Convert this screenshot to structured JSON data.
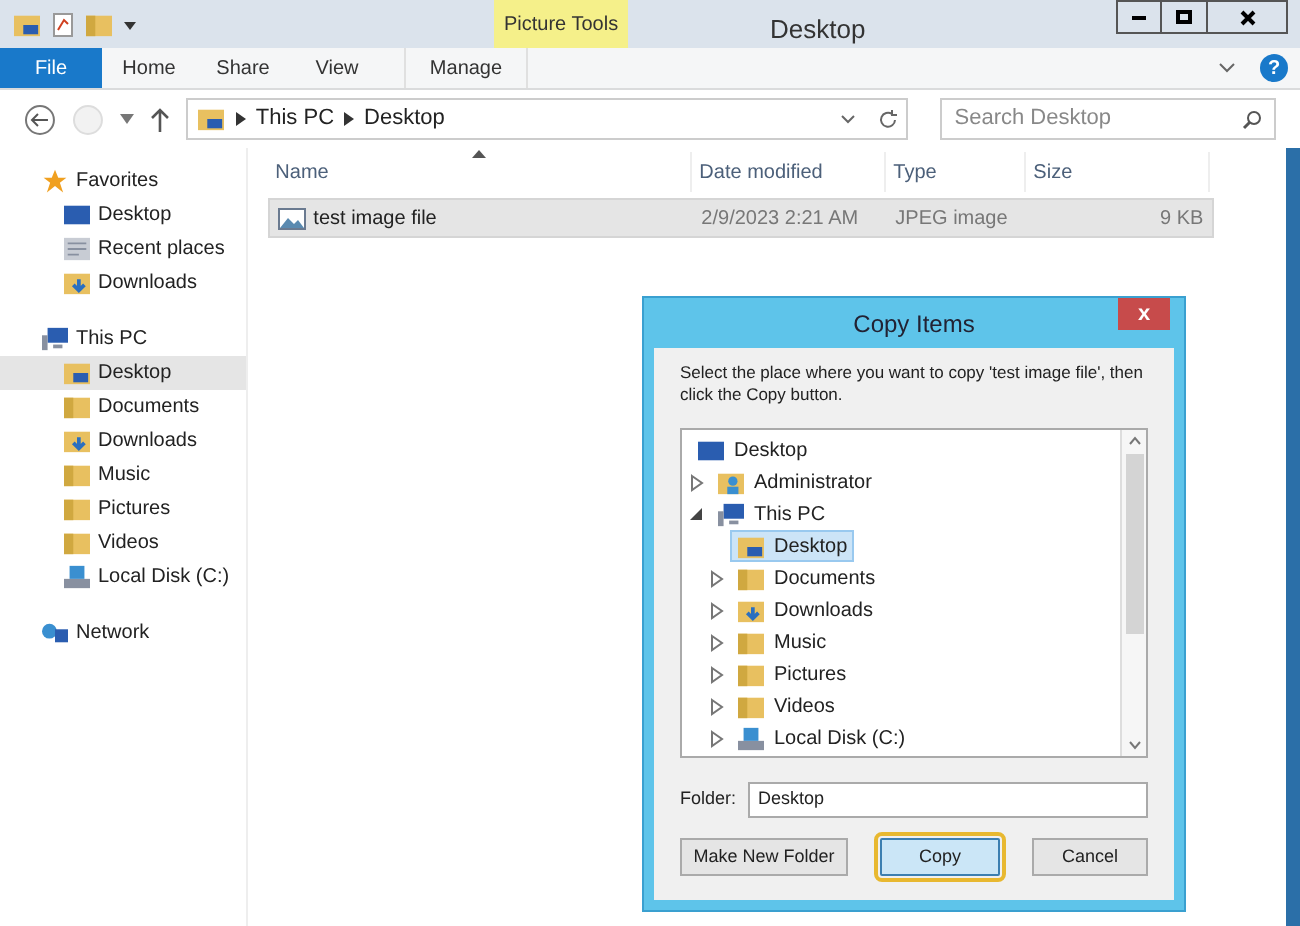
{
  "window": {
    "title": "Desktop",
    "context_tab": "Picture Tools",
    "help": "?"
  },
  "ribbon_tabs": [
    {
      "label": "File",
      "kind": "file"
    },
    {
      "label": "Home",
      "kind": "tab"
    },
    {
      "label": "Share",
      "kind": "tab"
    },
    {
      "label": "View",
      "kind": "tab"
    },
    {
      "label": "Manage",
      "kind": "context"
    }
  ],
  "address": {
    "path": [
      "This PC",
      "Desktop"
    ],
    "search_placeholder": "Search Desktop"
  },
  "sidebar": [
    {
      "label": "Favorites",
      "kind": "star",
      "children": [
        {
          "label": "Desktop",
          "kind": "desktop",
          "selected": false
        },
        {
          "label": "Recent places",
          "kind": "recent",
          "selected": false
        },
        {
          "label": "Downloads",
          "kind": "downloads",
          "selected": false
        }
      ]
    },
    {
      "label": "This PC",
      "kind": "pc",
      "children": [
        {
          "label": "Desktop",
          "kind": "desktop-folder",
          "selected": true
        },
        {
          "label": "Documents",
          "kind": "folder",
          "selected": false
        },
        {
          "label": "Downloads",
          "kind": "downloads",
          "selected": false
        },
        {
          "label": "Music",
          "kind": "folder",
          "selected": false
        },
        {
          "label": "Pictures",
          "kind": "folder",
          "selected": false
        },
        {
          "label": "Videos",
          "kind": "folder",
          "selected": false
        },
        {
          "label": "Local Disk (C:)",
          "kind": "disk",
          "selected": false
        }
      ]
    },
    {
      "label": "Network",
      "kind": "network"
    }
  ],
  "table": {
    "columns": [
      "Name",
      "Date modified",
      "Type",
      "Size"
    ],
    "rows": [
      {
        "cells": [
          "test image file",
          "2/9/2023 2:21 AM",
          "JPEG image",
          "9 KB"
        ],
        "selected": true
      }
    ]
  },
  "dialog": {
    "title": "Copy Items",
    "close": "x",
    "instruction": "Select the place where you want to copy 'test image file', then click the Copy button.",
    "tree": [
      {
        "label": "Desktop",
        "kind": "desktop",
        "selected": false
      },
      {
        "label": "Administrator",
        "kind": "user",
        "selected": false,
        "expanded": false
      },
      {
        "label": "This PC",
        "kind": "pc",
        "selected": false,
        "expanded": true,
        "children": [
          {
            "label": "Desktop",
            "kind": "desktop-folder",
            "selected": true
          },
          {
            "label": "Documents",
            "kind": "folder",
            "selected": false,
            "expanded": false
          },
          {
            "label": "Downloads",
            "kind": "downloads",
            "selected": false,
            "expanded": false
          },
          {
            "label": "Music",
            "kind": "folder",
            "selected": false,
            "expanded": false
          },
          {
            "label": "Pictures",
            "kind": "folder",
            "selected": false,
            "expanded": false
          },
          {
            "label": "Videos",
            "kind": "folder",
            "selected": false,
            "expanded": false
          },
          {
            "label": "Local Disk (C:)",
            "kind": "disk",
            "selected": false,
            "expanded": false
          }
        ]
      }
    ],
    "folder_label": "Folder:",
    "folder_value": "Desktop",
    "buttons": [
      {
        "label": "Make New Folder",
        "focused": false
      },
      {
        "label": "Copy",
        "focused": true
      },
      {
        "label": "Cancel",
        "focused": false
      }
    ]
  }
}
